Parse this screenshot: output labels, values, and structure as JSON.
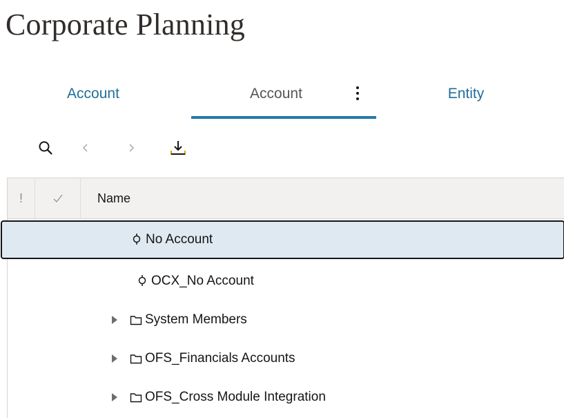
{
  "page": {
    "title": "Corporate Planning"
  },
  "tabs": [
    {
      "label": "Account",
      "selected": false
    },
    {
      "label": "Account",
      "selected": true
    },
    {
      "label": "Entity",
      "selected": false
    }
  ],
  "toolbar": {
    "search_icon": "search-icon",
    "prev_icon": "chevron-left-icon",
    "next_icon": "chevron-right-icon",
    "export_icon": "download-icon"
  },
  "grid": {
    "columns": {
      "status": "!",
      "name": "Name"
    },
    "rows": [
      {
        "label": "No Account",
        "icon": "member-node-icon",
        "expandable": false,
        "selected": true
      },
      {
        "label": "OCX_No Account",
        "icon": "member-node-icon",
        "expandable": false,
        "selected": false
      },
      {
        "label": "System Members",
        "icon": "folder-icon",
        "expandable": true,
        "selected": false
      },
      {
        "label": "OFS_Financials Accounts",
        "icon": "folder-icon",
        "expandable": true,
        "selected": false
      },
      {
        "label": "OFS_Cross Module Integration",
        "icon": "folder-icon",
        "expandable": true,
        "selected": false
      }
    ]
  },
  "colors": {
    "accent": "#227ba8",
    "tab_link": "#1f6f9a",
    "selected_row_bg": "#dfe9f2",
    "header_bg": "#f2f1ef"
  }
}
